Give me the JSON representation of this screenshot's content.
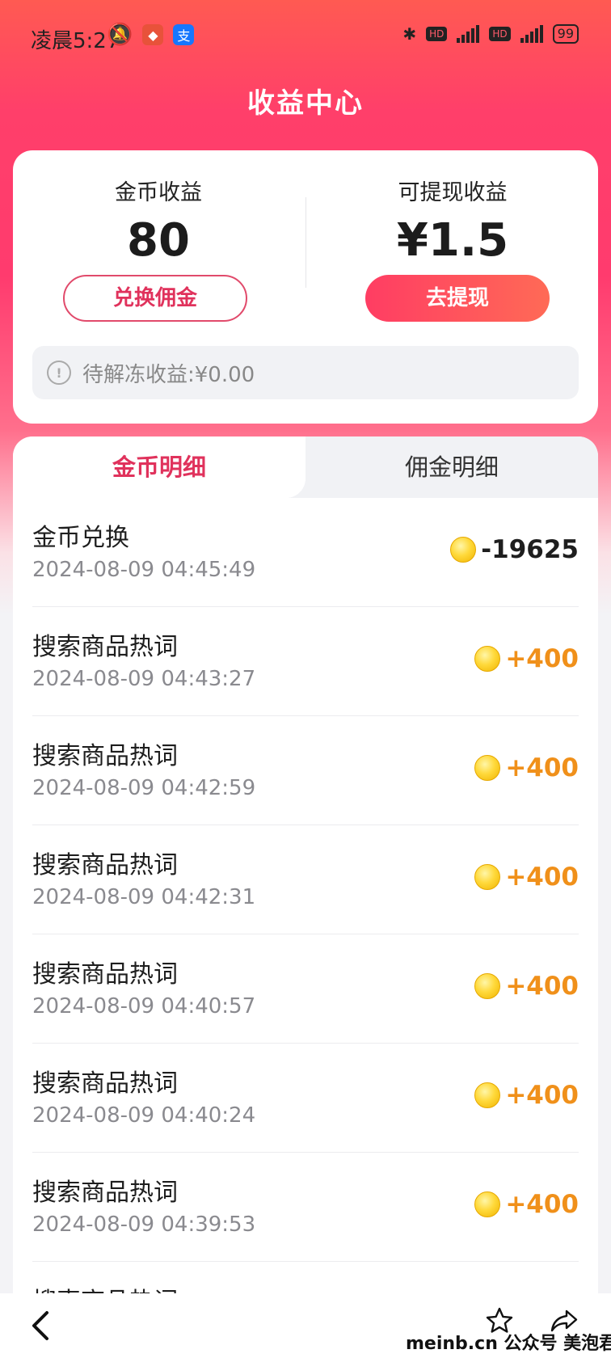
{
  "status_bar": {
    "time": "凌晨5:27",
    "battery": "99"
  },
  "header": {
    "title": "收益中心"
  },
  "summary": {
    "coins_label": "金币收益",
    "coins_value": "80",
    "withdrawable_label": "可提现收益",
    "withdrawable_value": "¥1.5",
    "exchange_button": "兑换佣金",
    "withdraw_button": "去提现",
    "pending_text": "待解冻收益:¥0.00"
  },
  "tabs": [
    {
      "label": "金币明细",
      "active": true
    },
    {
      "label": "佣金明细",
      "active": false
    }
  ],
  "records": [
    {
      "title": "金币兑换",
      "time": "2024-08-09 04:45:49",
      "amount": "-19625",
      "sign": "negative"
    },
    {
      "title": "搜索商品热词",
      "time": "2024-08-09 04:43:27",
      "amount": "+400",
      "sign": "positive"
    },
    {
      "title": "搜索商品热词",
      "time": "2024-08-09 04:42:59",
      "amount": "+400",
      "sign": "positive"
    },
    {
      "title": "搜索商品热词",
      "time": "2024-08-09 04:42:31",
      "amount": "+400",
      "sign": "positive"
    },
    {
      "title": "搜索商品热词",
      "time": "2024-08-09 04:40:57",
      "amount": "+400",
      "sign": "positive"
    },
    {
      "title": "搜索商品热词",
      "time": "2024-08-09 04:40:24",
      "amount": "+400",
      "sign": "positive"
    },
    {
      "title": "搜索商品热词",
      "time": "2024-08-09 04:39:53",
      "amount": "+400",
      "sign": "positive"
    },
    {
      "title": "搜索商品热词",
      "time": "",
      "amount": "",
      "sign": "positive"
    }
  ],
  "bottom_bar": {
    "watermark": "meinb.cn 公众号 美泡君"
  },
  "colors": {
    "accent": "#e0325c",
    "positive_amount": "#f0901a",
    "header_gradient_top": "#ff5a52",
    "header_gradient_mid": "#ff3b6e"
  }
}
